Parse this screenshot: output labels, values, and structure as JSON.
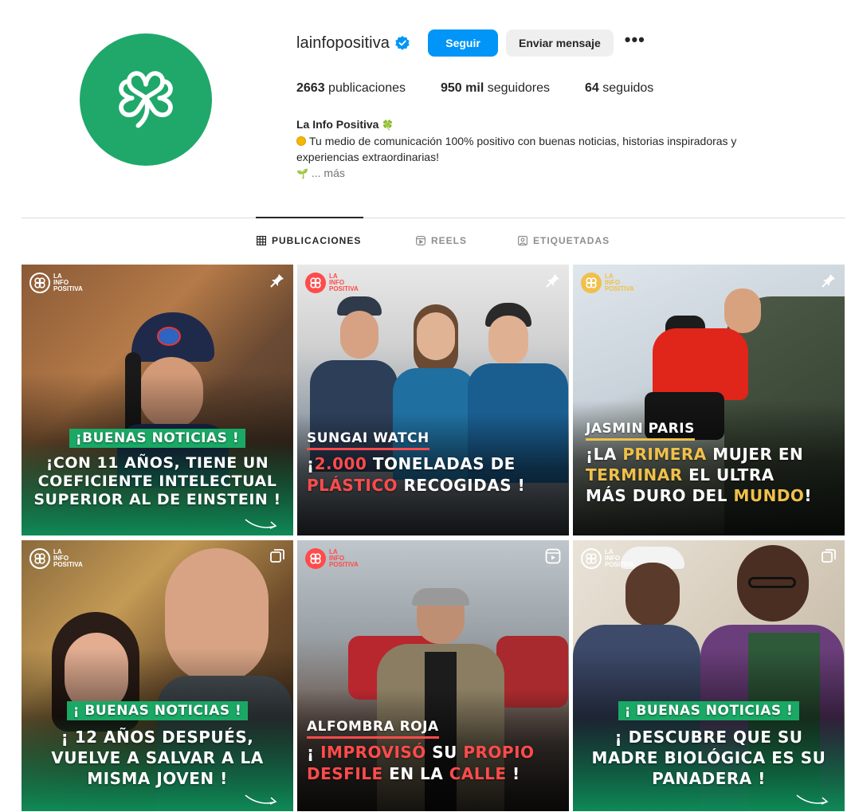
{
  "profile": {
    "username": "lainfopositiva",
    "verified": true,
    "follow_label": "Seguir",
    "message_label": "Enviar mensaje",
    "more_label": "•••",
    "stats": {
      "posts_count": "2663",
      "posts_label": "publicaciones",
      "followers_count": "950 mil",
      "followers_label": "seguidores",
      "following_count": "64",
      "following_label": "seguidos"
    },
    "bio": {
      "name": "La Info Positiva",
      "name_emoji": "🍀",
      "line1": "Tu medio de comunicación 100% positivo con buenas noticias, historias inspiradoras y",
      "line2": "experiencias extraordinarias!",
      "line3_emoji": "🌱",
      "more_label": "... más"
    },
    "avatar_color": "#1fa86a"
  },
  "tabs": [
    {
      "label": "PUBLICACIONES",
      "icon": "grid-icon",
      "active": true
    },
    {
      "label": "REELS",
      "icon": "reels-icon",
      "active": false
    },
    {
      "label": "ETIQUETADAS",
      "icon": "tagged-icon",
      "active": false
    }
  ],
  "brand": {
    "logo_text_1": "LA",
    "logo_text_2": "INFO",
    "logo_text_3": "POSITIVA"
  },
  "posts": [
    {
      "tag": "¡BUENAS NOTICIAS !",
      "lines": [
        "¡CON 11 AÑOS, TIENE UN",
        "COEFICIENTE INTELECTUAL",
        "SUPERIOR AL DE EINSTEIN !"
      ],
      "corner": "pin-icon"
    },
    {
      "tag": "SUNGAI WATCH",
      "lines_html": [
        [
          "¡",
          "2.000",
          " TONELADAS DE"
        ],
        [
          "PLÁSTICO",
          " RECOGIDAS !"
        ]
      ],
      "corner": "pin-icon"
    },
    {
      "tag": "JASMIN PARIS",
      "lines_html": [
        [
          "¡LA ",
          "PRIMERA",
          " MUJER EN"
        ],
        [
          "TERMINAR",
          " EL ULTRA"
        ],
        [
          "MÁS DURO DEL ",
          "MUNDO",
          "!"
        ]
      ],
      "corner": "pin-icon"
    },
    {
      "tag": "¡ BUENAS NOTICIAS !",
      "lines": [
        "¡ 12 AÑOS DESPUÉS,",
        "VUELVE A SALVAR A LA",
        "MISMA JOVEN !"
      ],
      "corner": "carousel-icon"
    },
    {
      "tag": "ALFOMBRA ROJA",
      "lines_html": [
        [
          "¡ ",
          "IMPROVISÓ",
          " SU ",
          "PROPIO"
        ],
        [
          "DESFILE",
          " EN LA ",
          "CALLE",
          " !"
        ]
      ],
      "corner": "reel-icon"
    },
    {
      "tag": "¡ BUENAS NOTICIAS !",
      "lines": [
        "¡ DESCUBRE QUE SU",
        "MADRE BIOLÓGICA ES SU",
        "PANADERA !"
      ],
      "corner": "carousel-icon"
    }
  ],
  "colors": {
    "accent_blue": "#0095f6",
    "brand_green": "#1aa865",
    "brand_red": "#ff4b4b",
    "brand_gold": "#f0c04a"
  }
}
